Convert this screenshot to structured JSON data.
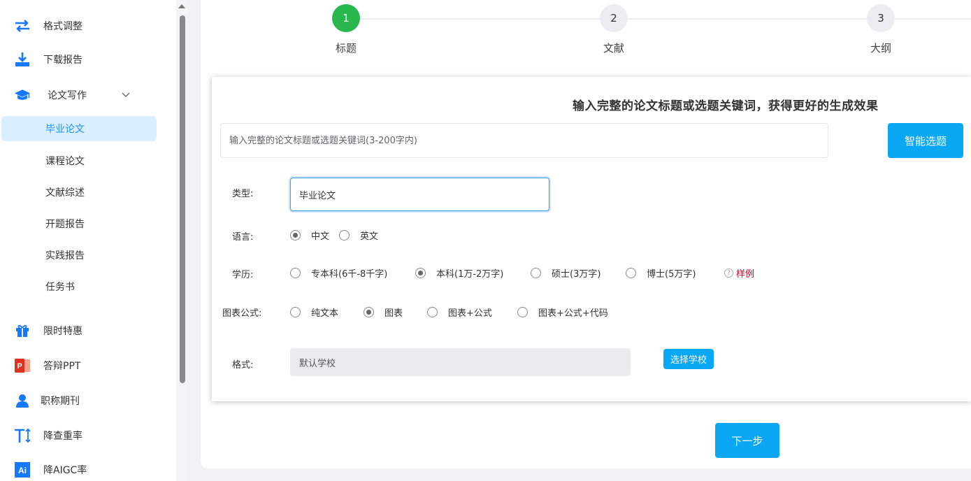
{
  "sidebar": {
    "items": [
      {
        "label": "格式调整",
        "icon": "swap-arrows-icon"
      },
      {
        "label": "下载报告",
        "icon": "download-icon"
      },
      {
        "label": "论文写作",
        "icon": "graduation-cap-icon"
      },
      {
        "label": "限时特惠",
        "icon": "gift-icon"
      },
      {
        "label": "答辩PPT",
        "icon": "powerpoint-icon"
      },
      {
        "label": "职称期刊",
        "icon": "user-icon"
      },
      {
        "label": "降查重率",
        "icon": "text-height-icon"
      },
      {
        "label": "降AIGC率",
        "icon": "ai-icon"
      }
    ],
    "sub_items": [
      {
        "label": "毕业论文",
        "active": true
      },
      {
        "label": "课程论文",
        "active": false
      },
      {
        "label": "文献综述",
        "active": false
      },
      {
        "label": "开题报告",
        "active": false
      },
      {
        "label": "实践报告",
        "active": false
      },
      {
        "label": "任务书",
        "active": false
      }
    ],
    "ai_icon_text": "Ai",
    "ppt_icon_text": "P"
  },
  "steps": [
    {
      "number": "1",
      "label": "标题",
      "done": true
    },
    {
      "number": "2",
      "label": "文献",
      "done": false
    },
    {
      "number": "3",
      "label": "大纲",
      "done": false
    }
  ],
  "form": {
    "title": "输入完整的论文标题或选题关键词，获得更好的生成效果",
    "topic_placeholder": "输入完整的论文标题或选题关键词(3-200字内)",
    "smart_button": "智能选题",
    "type_label": "类型:",
    "type_value": "毕业论文",
    "language_label": "语言:",
    "language_options": [
      "中文",
      "英文"
    ],
    "language_selected": "中文",
    "degree_label": "学历:",
    "degree_options": [
      "专本科(6千-8千字)",
      "本科(1万-2万字)",
      "硕士(3万字)",
      "博士(5万字)"
    ],
    "degree_selected": "本科(1万-2万字)",
    "sample_label": "样例",
    "sample_icon_text": "?",
    "chart_label": "图表公式:",
    "chart_options": [
      "纯文本",
      "图表",
      "图表+公式",
      "图表+公式+代码"
    ],
    "chart_selected": "图表",
    "format_label": "格式:",
    "format_value": "默认学校",
    "select_school_button": "选择学校",
    "next_button": "下一步"
  },
  "colors": {
    "accent": "#0aa7f5",
    "step_done": "#28b84d",
    "active_menu_bg": "#d9effd",
    "sample_red": "#d9001b"
  }
}
